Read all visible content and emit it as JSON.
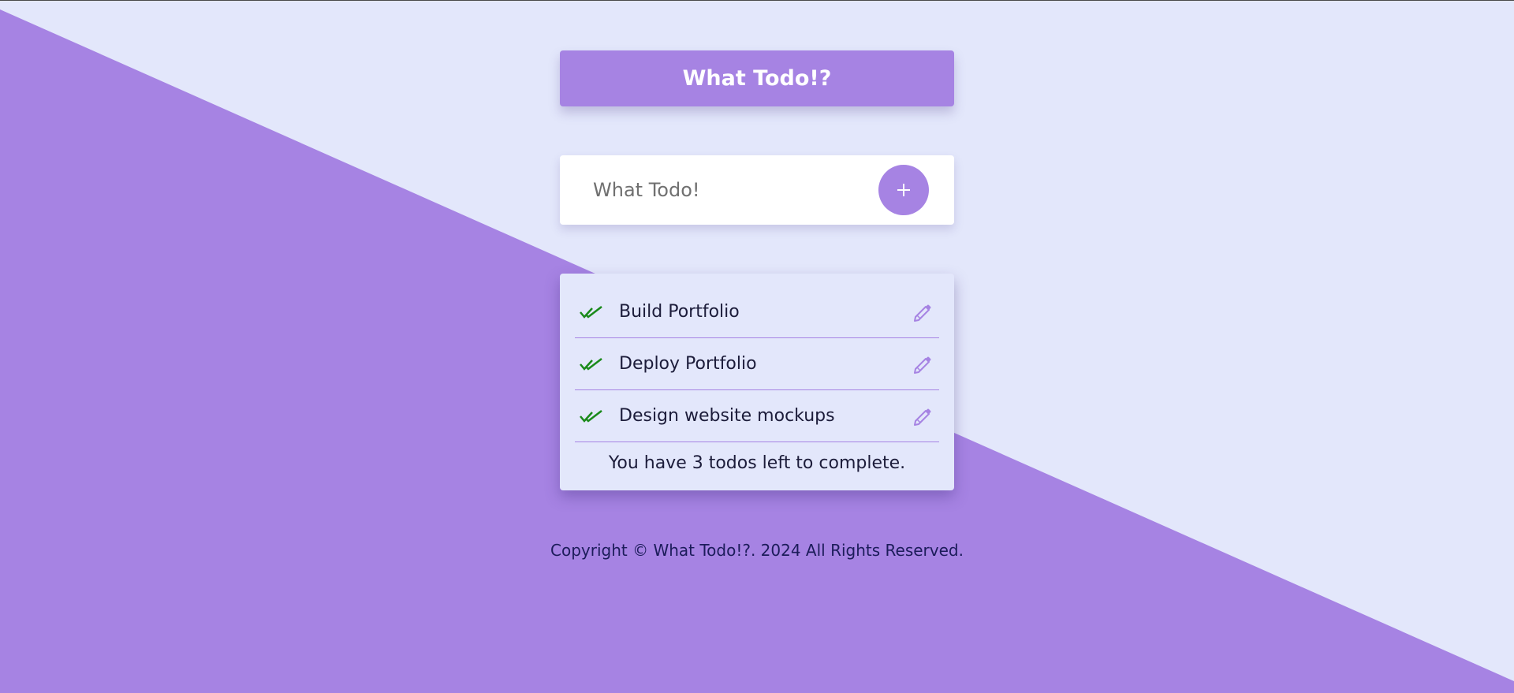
{
  "header": {
    "title": "What Todo!?"
  },
  "input": {
    "placeholder": "What Todo!",
    "add_icon": "plus-icon"
  },
  "todos": [
    {
      "text": "Build Portfolio",
      "status_icon": "double-check-icon",
      "edit_icon": "pencil-icon"
    },
    {
      "text": "Deploy Portfolio",
      "status_icon": "double-check-icon",
      "edit_icon": "pencil-icon"
    },
    {
      "text": "Design website mockups",
      "status_icon": "double-check-icon",
      "edit_icon": "pencil-icon"
    }
  ],
  "summary": {
    "remaining_text": "You have 3 todos left to complete."
  },
  "footer": {
    "copyright": "Copyright © What Todo!?.  2024 All Rights Reserved."
  },
  "colors": {
    "accent": "#a683e3",
    "background_light": "#e3e7fb",
    "check_green": "#1a8a1a",
    "text_dark": "#1c1c3a"
  }
}
